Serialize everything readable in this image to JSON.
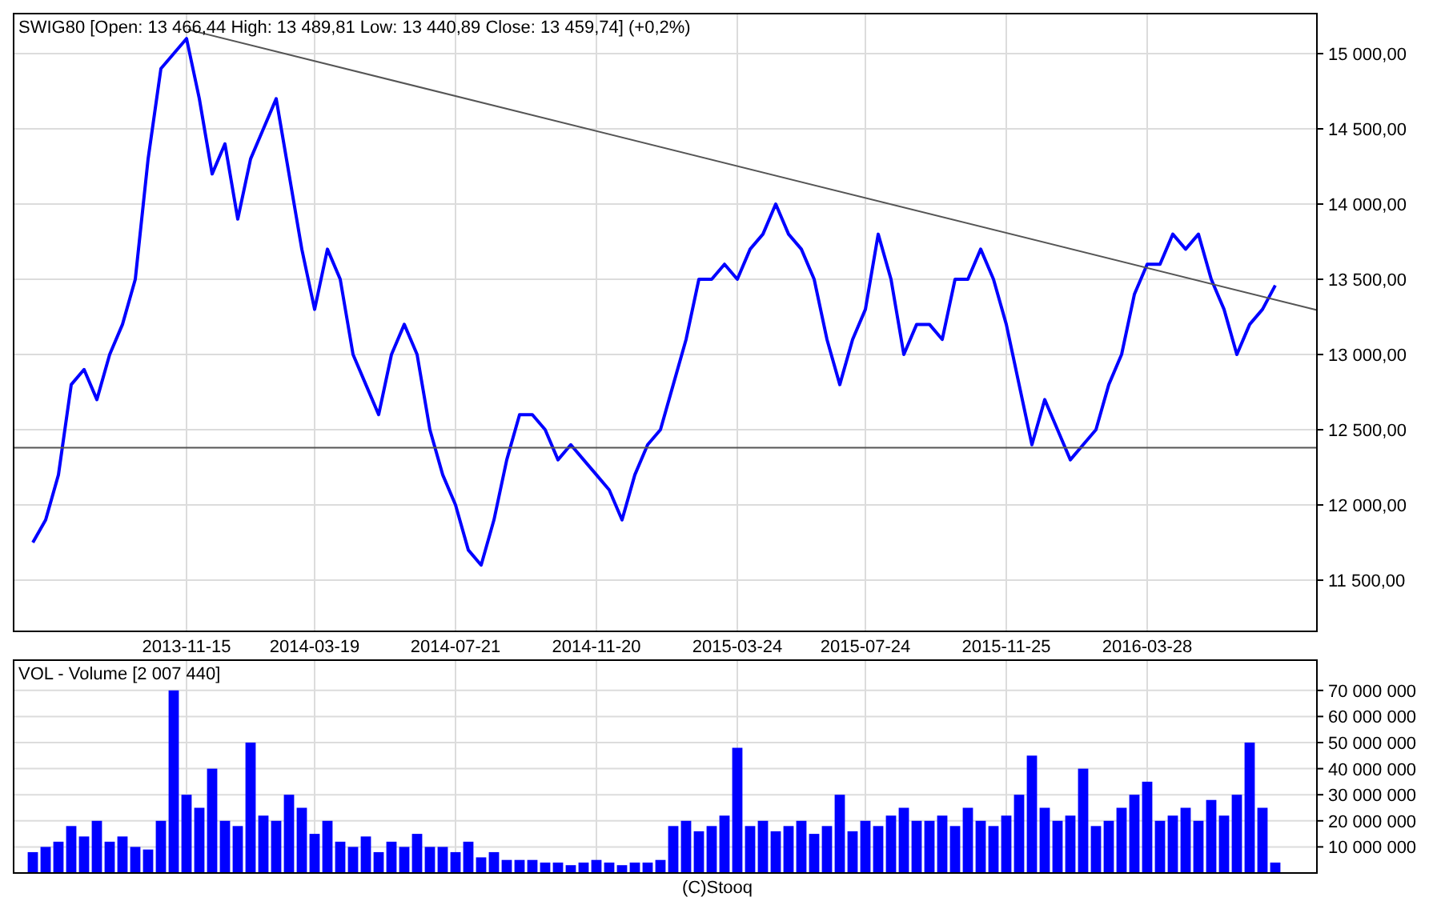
{
  "price_chart": {
    "chart_data": {
      "type": "line",
      "title": "SWIG80 [Open: 13 466,44  High: 13 489,81  Low: 13 440,89  Close: 13 459,74] (+0,2%)",
      "grid": true,
      "categories": [
        null,
        null,
        null,
        null,
        null,
        null,
        null,
        null,
        null,
        null,
        null,
        null,
        "2013-11-15",
        null,
        null,
        null,
        null,
        null,
        null,
        null,
        null,
        null,
        "2014-03-19",
        null,
        null,
        null,
        null,
        null,
        null,
        null,
        null,
        null,
        null,
        "2014-07-21",
        null,
        null,
        null,
        null,
        null,
        null,
        null,
        null,
        null,
        null,
        "2014-11-20",
        null,
        null,
        null,
        null,
        null,
        null,
        null,
        null,
        null,
        null,
        "2015-03-24",
        null,
        null,
        null,
        null,
        null,
        null,
        null,
        null,
        null,
        "2015-07-24",
        null,
        null,
        null,
        null,
        null,
        null,
        null,
        null,
        null,
        null,
        "2015-11-25",
        null,
        null,
        null,
        null,
        null,
        null,
        null,
        null,
        null,
        null,
        "2016-03-28",
        null,
        null,
        null,
        null,
        null,
        null,
        null,
        null,
        null,
        null
      ],
      "ylim": [
        11160,
        15266
      ],
      "yticks": [
        {
          "value": 11500,
          "label": "11 500,00"
        },
        {
          "value": 12000,
          "label": "12 000,00"
        },
        {
          "value": 12500,
          "label": "12 500,00"
        },
        {
          "value": 13000,
          "label": "13 000,00"
        },
        {
          "value": 13500,
          "label": "13 500,00"
        },
        {
          "value": 14000,
          "label": "14 000,00"
        },
        {
          "value": 14500,
          "label": "14 500,00"
        },
        {
          "value": 15000,
          "label": "15 000,00"
        }
      ],
      "series": [
        {
          "color": "#0000ff",
          "values": [
            11750,
            11900,
            12200,
            12800,
            12900,
            12700,
            13000,
            13200,
            13500,
            14300,
            14900,
            15000,
            15100,
            14700,
            14200,
            14400,
            13900,
            14300,
            14500,
            14700,
            14200,
            13700,
            13300,
            13700,
            13500,
            13000,
            12800,
            12600,
            13000,
            13200,
            13000,
            12500,
            12200,
            12000,
            11700,
            11600,
            11900,
            12300,
            12600,
            12600,
            12500,
            12300,
            12400,
            12300,
            12200,
            12100,
            11900,
            12200,
            12400,
            12500,
            12800,
            13100,
            13500,
            13500,
            13600,
            13500,
            13700,
            13800,
            14000,
            13800,
            13700,
            13500,
            13100,
            12800,
            13100,
            13300,
            13800,
            13500,
            13000,
            13200,
            13200,
            13100,
            13500,
            13500,
            13700,
            13500,
            13200,
            12800,
            12400,
            12700,
            12500,
            12300,
            12400,
            12500,
            12800,
            13000,
            13400,
            13600,
            13600,
            13800,
            13700,
            13800,
            13500,
            13300,
            13000,
            13200,
            13300,
            13460
          ]
        }
      ],
      "ref_lines": [
        {
          "axis": "y",
          "value": 12380
        }
      ],
      "stacked": false
    }
  },
  "volume_chart": {
    "chart_data": {
      "type": "bar",
      "title": "VOL - Volume [2 007 440]",
      "grid": true,
      "ylim": [
        0,
        81600000
      ],
      "yticks": [
        {
          "value": 10000000,
          "label": "10 000 000"
        },
        {
          "value": 20000000,
          "label": "20 000 000"
        },
        {
          "value": 30000000,
          "label": "30 000 000"
        },
        {
          "value": 40000000,
          "label": "40 000 000"
        },
        {
          "value": 50000000,
          "label": "50 000 000"
        },
        {
          "value": 60000000,
          "label": "60 000 000"
        },
        {
          "value": 70000000,
          "label": "70 000 000"
        }
      ],
      "series": [
        {
          "color": "#0000ff",
          "values": [
            8000000,
            10000000,
            12000000,
            18000000,
            14000000,
            20000000,
            12000000,
            14000000,
            10000000,
            9000000,
            20000000,
            70000000,
            30000000,
            25000000,
            40000000,
            20000000,
            18000000,
            50000000,
            22000000,
            20000000,
            30000000,
            25000000,
            15000000,
            20000000,
            12000000,
            10000000,
            14000000,
            8000000,
            12000000,
            10000000,
            15000000,
            10000000,
            10000000,
            8000000,
            12000000,
            6000000,
            8000000,
            5000000,
            5000000,
            5000000,
            4000000,
            4000000,
            3000000,
            4000000,
            5000000,
            4000000,
            3000000,
            4000000,
            4000000,
            5000000,
            18000000,
            20000000,
            16000000,
            18000000,
            22000000,
            48000000,
            18000000,
            20000000,
            16000000,
            18000000,
            20000000,
            15000000,
            18000000,
            30000000,
            16000000,
            20000000,
            18000000,
            22000000,
            25000000,
            20000000,
            20000000,
            22000000,
            18000000,
            25000000,
            20000000,
            18000000,
            22000000,
            30000000,
            45000000,
            25000000,
            20000000,
            22000000,
            40000000,
            18000000,
            20000000,
            25000000,
            30000000,
            35000000,
            20000000,
            22000000,
            25000000,
            20000000,
            28000000,
            22000000,
            30000000,
            50000000,
            25000000,
            4000000
          ]
        }
      ]
    }
  },
  "footer": "(C)Stooq"
}
